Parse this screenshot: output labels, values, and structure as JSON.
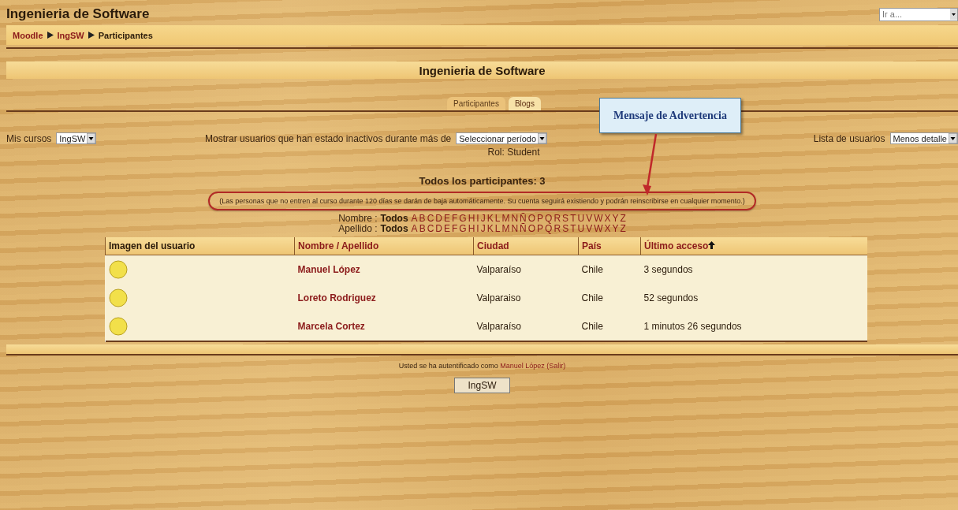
{
  "header": {
    "title": "Ingenieria de Software",
    "jump_select": {
      "placeholder": "Ir a..."
    }
  },
  "breadcrumb": [
    {
      "label": "Moodle",
      "link": true
    },
    {
      "label": "IngSW",
      "link": true
    },
    {
      "label": "Participantes",
      "link": false
    }
  ],
  "heading": "Ingenieria de Software",
  "tabs": [
    {
      "label": "Participantes",
      "selected": false
    },
    {
      "label": "Blogs",
      "selected": true
    }
  ],
  "callout": {
    "text": "Mensaje de Advertencia"
  },
  "controls": {
    "my_courses": {
      "label": "Mis cursos",
      "value": "IngSW"
    },
    "inactive": {
      "label": "Mostrar usuarios que han estado inactivos durante más de",
      "value": "Seleccionar período"
    },
    "user_list": {
      "label": "Lista de usuarios",
      "value": "Menos detalle"
    }
  },
  "role": "Rol: Student",
  "total": "Todos los participantes: 3",
  "notice": "(Las personas que no entren al curso durante 120 días se darán de baja automáticamente. Su cuenta seguirá existiendo y podrán reinscribirse en cualquier momento.)",
  "filters": [
    {
      "label": "Nombre :",
      "all": "Todos",
      "letters": [
        "A",
        "B",
        "C",
        "D",
        "E",
        "F",
        "G",
        "H",
        "I",
        "J",
        "K",
        "L",
        "M",
        "N",
        "Ñ",
        "O",
        "P",
        "Q",
        "R",
        "S",
        "T",
        "U",
        "V",
        "W",
        "X",
        "Y",
        "Z"
      ]
    },
    {
      "label": "Apellido :",
      "all": "Todos",
      "letters": [
        "A",
        "B",
        "C",
        "D",
        "E",
        "F",
        "G",
        "H",
        "I",
        "J",
        "K",
        "L",
        "M",
        "N",
        "Ñ",
        "O",
        "P",
        "Q",
        "R",
        "S",
        "T",
        "U",
        "V",
        "W",
        "X",
        "Y",
        "Z"
      ]
    }
  ],
  "table": {
    "columns": [
      {
        "label": "Imagen del usuario",
        "link": false,
        "sorted": false
      },
      {
        "label": "Nombre / Apellido",
        "link": true,
        "sorted": false
      },
      {
        "label": "Ciudad",
        "link": true,
        "sorted": false
      },
      {
        "label": "País",
        "link": true,
        "sorted": false
      },
      {
        "label": "Último acceso",
        "link": true,
        "sorted": true
      }
    ],
    "rows": [
      {
        "name": "Manuel López",
        "city": "Valparaíso",
        "country": "Chile",
        "last_access": "3 segundos"
      },
      {
        "name": "Loreto Rodriguez",
        "city": "Valparaiso",
        "country": "Chile",
        "last_access": "52 segundos"
      },
      {
        "name": "Marcela Cortez",
        "city": "Valparaíso",
        "country": "Chile",
        "last_access": "1 minutos 26 segundos"
      }
    ]
  },
  "footer": {
    "login_text": "Usted se ha autentificado como",
    "user": "Manuel López",
    "logout": "(Salir)",
    "course_button": "IngSW"
  }
}
